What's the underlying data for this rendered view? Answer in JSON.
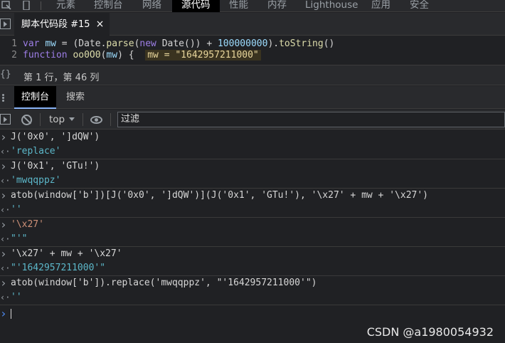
{
  "topbar": {
    "tabs": [
      "元素",
      "控制台",
      "网络",
      "源代码",
      "性能",
      "内存",
      "Lighthouse",
      "应用",
      "安全"
    ],
    "active_tab": "源代码"
  },
  "editor": {
    "file_tab": "脚本代码段 #15",
    "close_glyph": "×",
    "lines": [
      {
        "num": "1",
        "text": "var mw = (Date.parse(new Date()) + 100000000).toString()"
      },
      {
        "num": "2",
        "text": "function oo0O0(mw) {",
        "inline_value": "mw = \"1642957211000\""
      }
    ]
  },
  "status": {
    "braces": "{}",
    "cursor_position": "第 1 行，第 46 列"
  },
  "drawer": {
    "tabs": [
      "控制台",
      "搜索"
    ],
    "active": "控制台"
  },
  "console_toolbar": {
    "context": "top",
    "filter_placeholder": "过滤"
  },
  "console": {
    "entries": [
      {
        "input": "J('0x0', ']dQW')",
        "output": "'replace'"
      },
      {
        "input": "J('0x1', 'GTu!')",
        "output": "'mwqqppz'"
      },
      {
        "input": "atob(window['b'])[J('0x0', ']dQW')](J('0x1', 'GTu!'), '\\x27' + mw + '\\x27')",
        "output": "''"
      },
      {
        "input": "'\\x27'",
        "output": "\"'\""
      },
      {
        "input": "'\\x27' + mw + '\\x27'",
        "output": "\"'1642957211000'\""
      },
      {
        "input": "atob(window['b']).replace('mwqqppz', \"'1642957211000'\")",
        "output": "''"
      }
    ]
  },
  "watermark": "CSDN @a1980054932"
}
